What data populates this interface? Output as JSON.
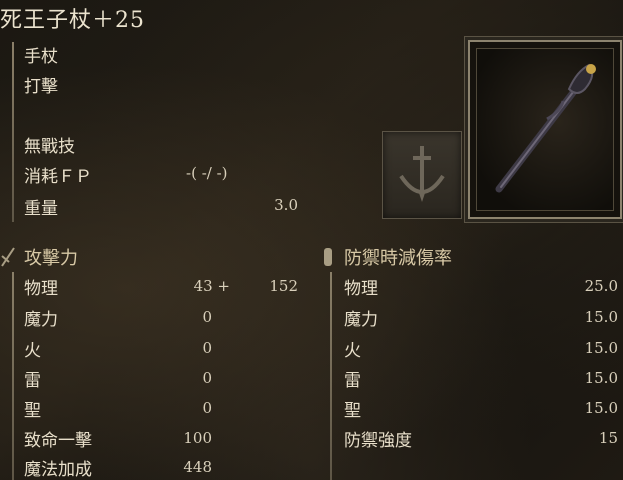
{
  "item": {
    "name": "死王子杖＋25",
    "category": "手杖",
    "attack_type": "打擊",
    "skill": "無戰技",
    "fp_label": "消耗ＦＰ",
    "fp_value": "-(  -/  -)",
    "weight_label": "重量",
    "weight_value": "3.0"
  },
  "attack": {
    "header": "攻擊力",
    "rows": [
      {
        "label": "物理",
        "base": "43 +",
        "bonus": "152"
      },
      {
        "label": "魔力",
        "base": "0",
        "bonus": ""
      },
      {
        "label": "火",
        "base": "0",
        "bonus": ""
      },
      {
        "label": "雷",
        "base": "0",
        "bonus": ""
      },
      {
        "label": "聖",
        "base": "0",
        "bonus": ""
      },
      {
        "label": "致命一擊",
        "base": "100",
        "bonus": ""
      },
      {
        "label": "魔法加成",
        "base": "448",
        "bonus": ""
      }
    ]
  },
  "guard": {
    "header": "防禦時減傷率",
    "rows": [
      {
        "label": "物理",
        "value": "25.0"
      },
      {
        "label": "魔力",
        "value": "15.0"
      },
      {
        "label": "火",
        "value": "15.0"
      },
      {
        "label": "雷",
        "value": "15.0"
      },
      {
        "label": "聖",
        "value": "15.0"
      },
      {
        "label": "防禦強度",
        "value": "15"
      }
    ]
  },
  "icons": {
    "attack_header": "sword-icon",
    "guard_header": "shield-icon",
    "skill_slot": "sword-emblem-icon",
    "weapon": "staff-image"
  }
}
